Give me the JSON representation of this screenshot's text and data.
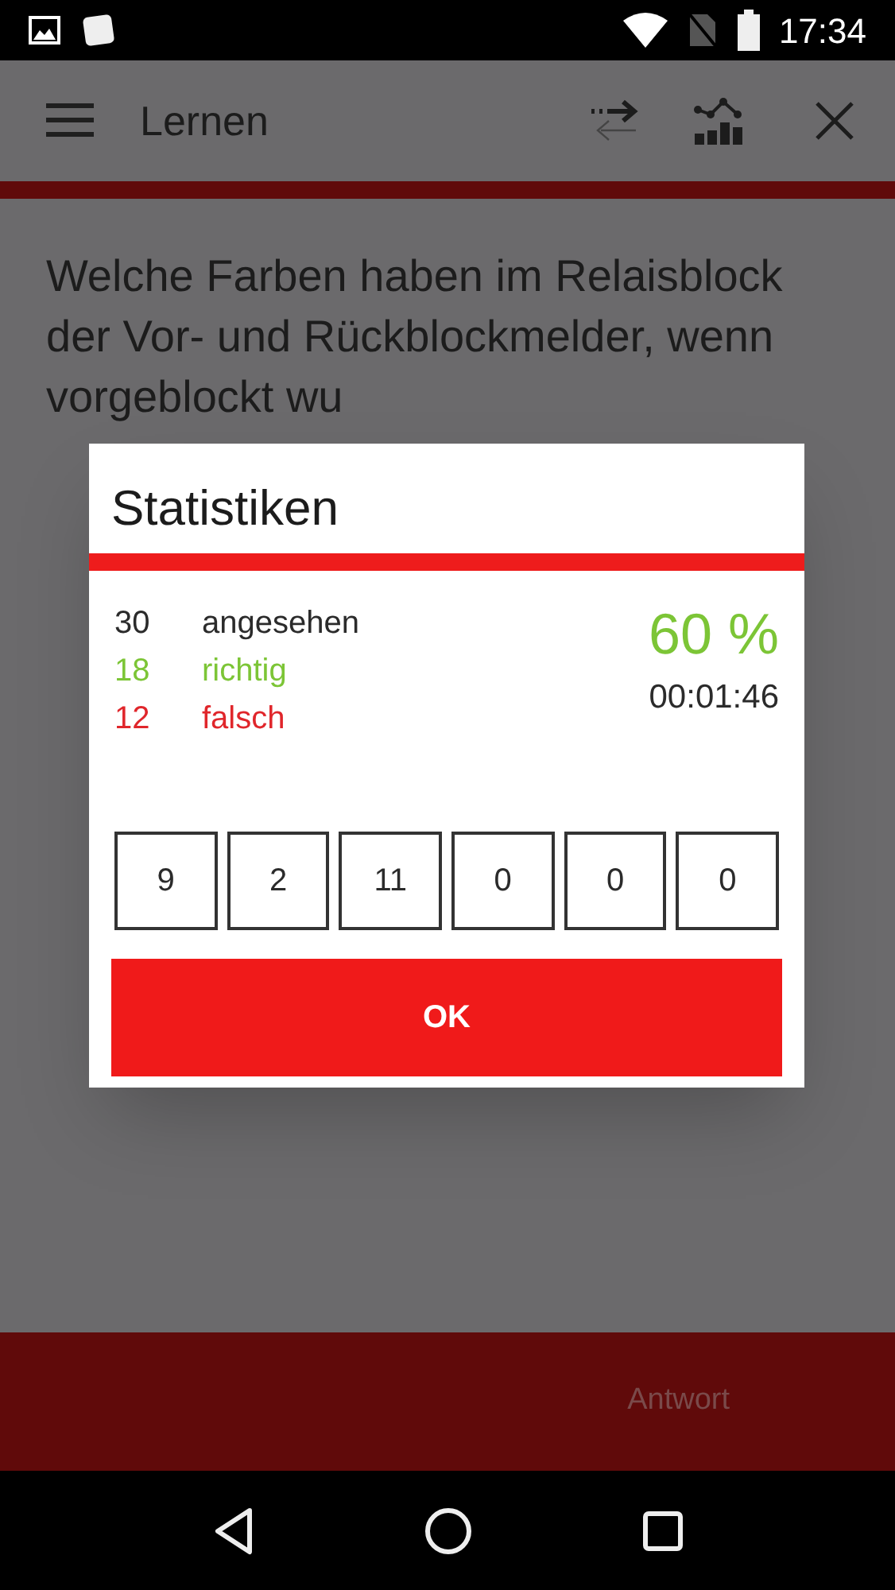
{
  "status_bar": {
    "time": "17:34"
  },
  "app_bar": {
    "title": "Lernen"
  },
  "question": "Welche Farben haben im Relaisblock der Vor- und Rückblockmelder, wenn vorgeblockt wu",
  "bottom_bar": {
    "button": "Antwort"
  },
  "dialog": {
    "title": "Statistiken",
    "stats": [
      {
        "count": "30",
        "label": "angesehen",
        "color": "#2b2b2b"
      },
      {
        "count": "18",
        "label": "richtig",
        "color": "#7cc536"
      },
      {
        "count": "12",
        "label": "falsch",
        "color": "#e0262b"
      }
    ],
    "percent": "60 %",
    "time": "00:01:46",
    "boxes": [
      "9",
      "2",
      "11",
      "0",
      "0",
      "0"
    ],
    "ok": "OK"
  }
}
